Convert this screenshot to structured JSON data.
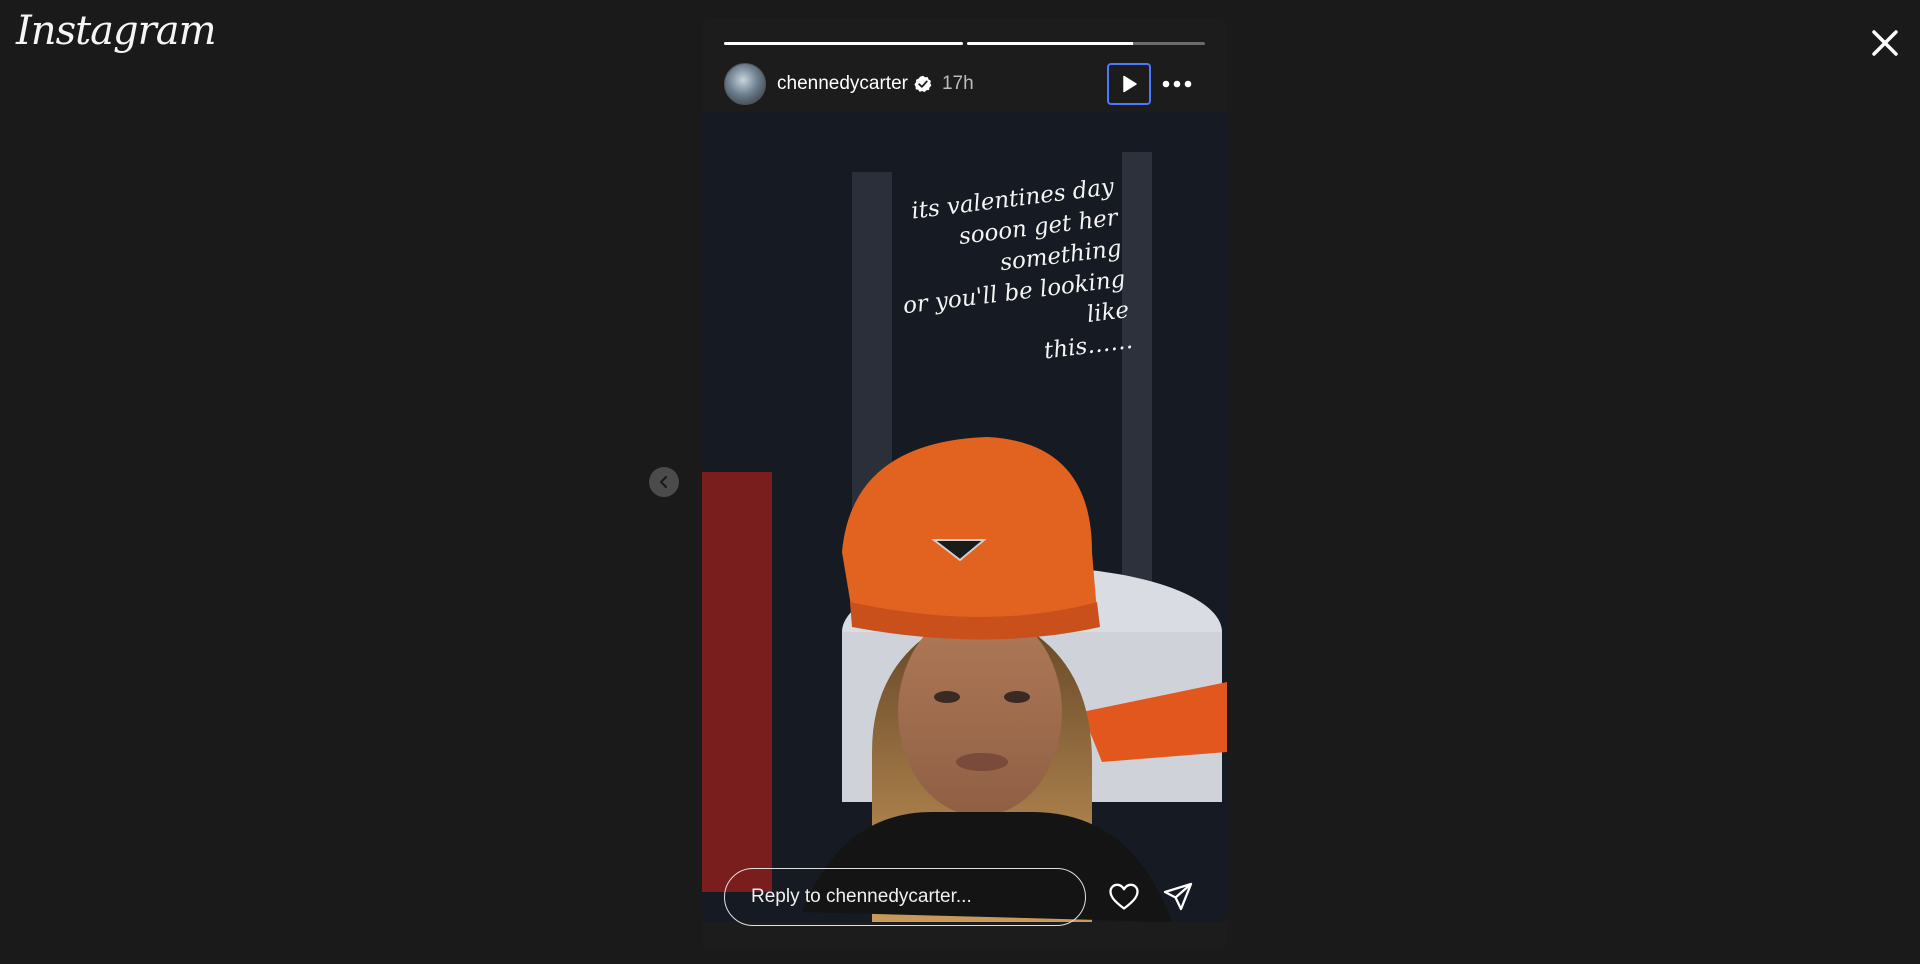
{
  "app": {
    "logo_text": "Instagram"
  },
  "story": {
    "progress": [
      1.0,
      0.7
    ],
    "username": "chennedycarter",
    "verified": true,
    "time_ago": "17h",
    "caption": "its valentines day\nsooon get her something\nor you'll be looking like\nthis……",
    "reply_placeholder": "Reply to chennedycarter..."
  },
  "icons": {
    "close": "close-icon",
    "prev": "chevron-left-icon",
    "play": "play-icon",
    "more": "more-horizontal-icon",
    "like": "heart-icon",
    "share": "send-icon",
    "verified": "verified-badge-icon"
  },
  "colors": {
    "background": "#1a1a1a",
    "focus_outline": "#4a78ff"
  }
}
